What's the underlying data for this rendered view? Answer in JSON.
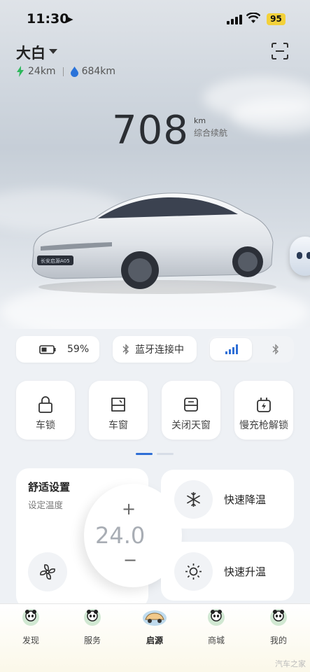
{
  "status_bar": {
    "time": "11:30",
    "battery": "95"
  },
  "header": {
    "car_name": "大白",
    "electric_range": "24km",
    "fuel_range": "684km"
  },
  "range": {
    "value": "708",
    "unit": "km",
    "label": "综合续航"
  },
  "car_badge": "长安启源A05",
  "status_chips": {
    "battery_percent": "59%",
    "bluetooth": "蓝牙连接中"
  },
  "controls": [
    {
      "label": "车锁",
      "icon": "lock-icon"
    },
    {
      "label": "车窗",
      "icon": "window-icon"
    },
    {
      "label": "关闭天窗",
      "icon": "sunroof-icon"
    },
    {
      "label": "慢充枪解锁",
      "icon": "charger-icon"
    }
  ],
  "comfort": {
    "title": "舒适设置",
    "subtitle": "设定温度",
    "temperature": "24.0",
    "plus": "+",
    "minus": "−"
  },
  "quick": {
    "cool": "快速降温",
    "heat": "快速升温"
  },
  "nav": [
    {
      "label": "发现"
    },
    {
      "label": "服务"
    },
    {
      "label": "启源",
      "active": true
    },
    {
      "label": "商城"
    },
    {
      "label": "我的"
    }
  ],
  "watermark": "汽车之家",
  "colors": {
    "electric": "#2eb85c",
    "fuel": "#2a73d9",
    "accent": "#2f6fd6",
    "battery_badge": "#f3d13a"
  }
}
